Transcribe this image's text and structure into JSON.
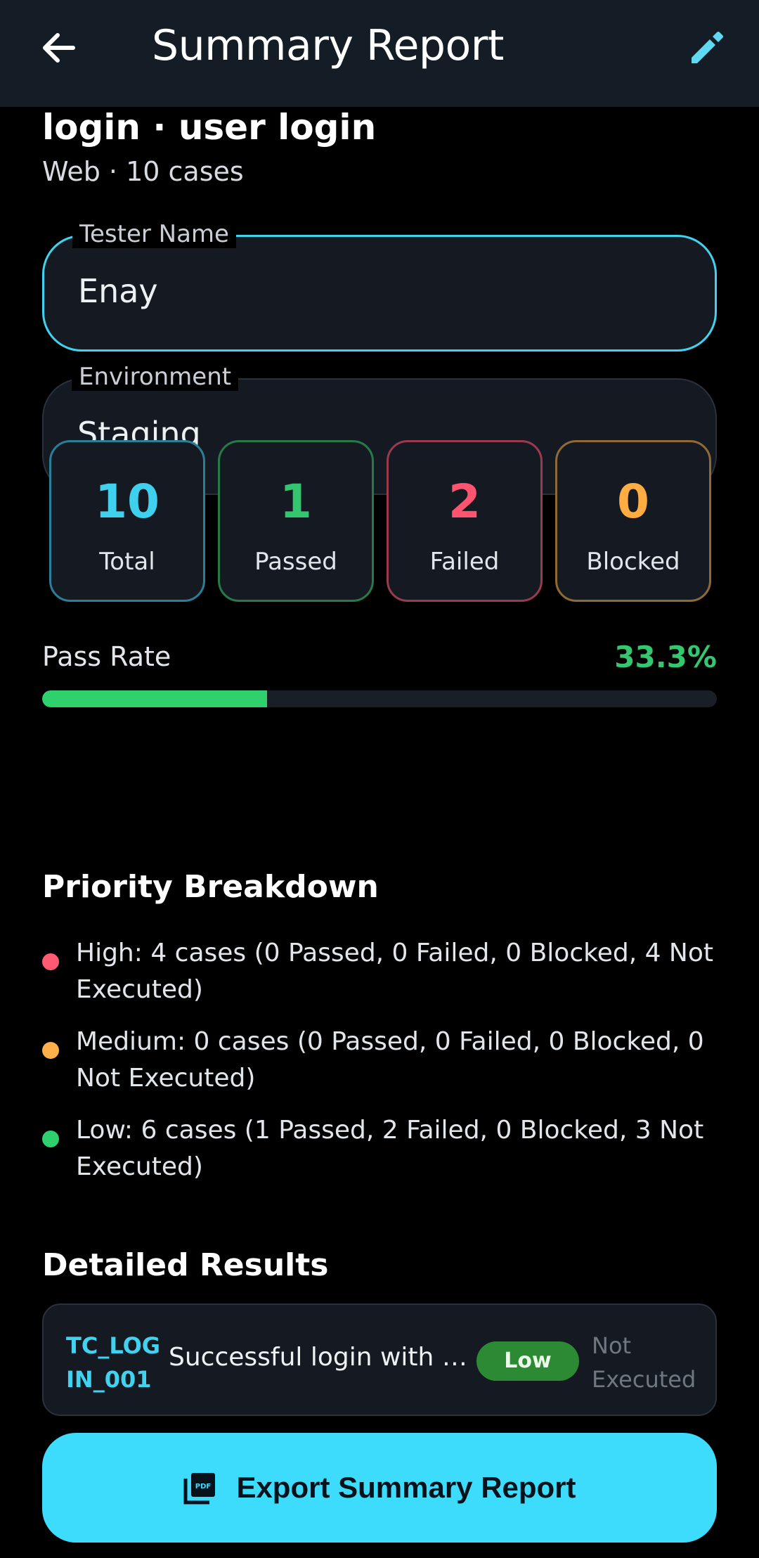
{
  "appbar": {
    "title": "Summary Report",
    "back_icon": "arrow-back-icon",
    "edit_icon": "pencil-edit-icon"
  },
  "report": {
    "heading": "login · user login",
    "subheading": "Web · 10 cases"
  },
  "fields": {
    "tester": {
      "label": "Tester Name",
      "value": "Enay"
    },
    "environment": {
      "label": "Environment",
      "value": "Staging"
    }
  },
  "stats": [
    {
      "value": "10",
      "label": "Total",
      "color": "#3fd0ee",
      "border": "#2a7f98"
    },
    {
      "value": "1",
      "label": "Passed",
      "color": "#33c56f",
      "border": "#267a48"
    },
    {
      "value": "2",
      "label": "Failed",
      "color": "#ff5470",
      "border": "#9a3a4e"
    },
    {
      "value": "0",
      "label": "Blocked",
      "color": "#ffad42",
      "border": "#8f6a34"
    }
  ],
  "pass_rate": {
    "label": "Pass Rate",
    "value": "33.3%",
    "fraction": 0.333
  },
  "priority": {
    "title": "Priority Breakdown",
    "items": [
      {
        "text": "High: 4 cases (0 Passed, 0 Failed, 0 Blocked, 4 Not Executed)",
        "color": "#ff5a73"
      },
      {
        "text": "Medium: 0 cases (0 Passed, 0 Failed, 0 Blocked, 0 Not Executed)",
        "color": "#ffb04a"
      },
      {
        "text": "Low: 6 cases (1 Passed, 2 Failed, 0 Blocked, 3 Not Executed)",
        "color": "#2ecf6c"
      }
    ]
  },
  "details": {
    "title": "Detailed Results",
    "rows": [
      {
        "id": "TC_LOGIN_001",
        "title": "Successful login with valid credentials",
        "priority": "Low",
        "status": "Not Executed"
      }
    ]
  },
  "export": {
    "label": "Export Summary Report",
    "icon": "pdf-file-icon"
  }
}
